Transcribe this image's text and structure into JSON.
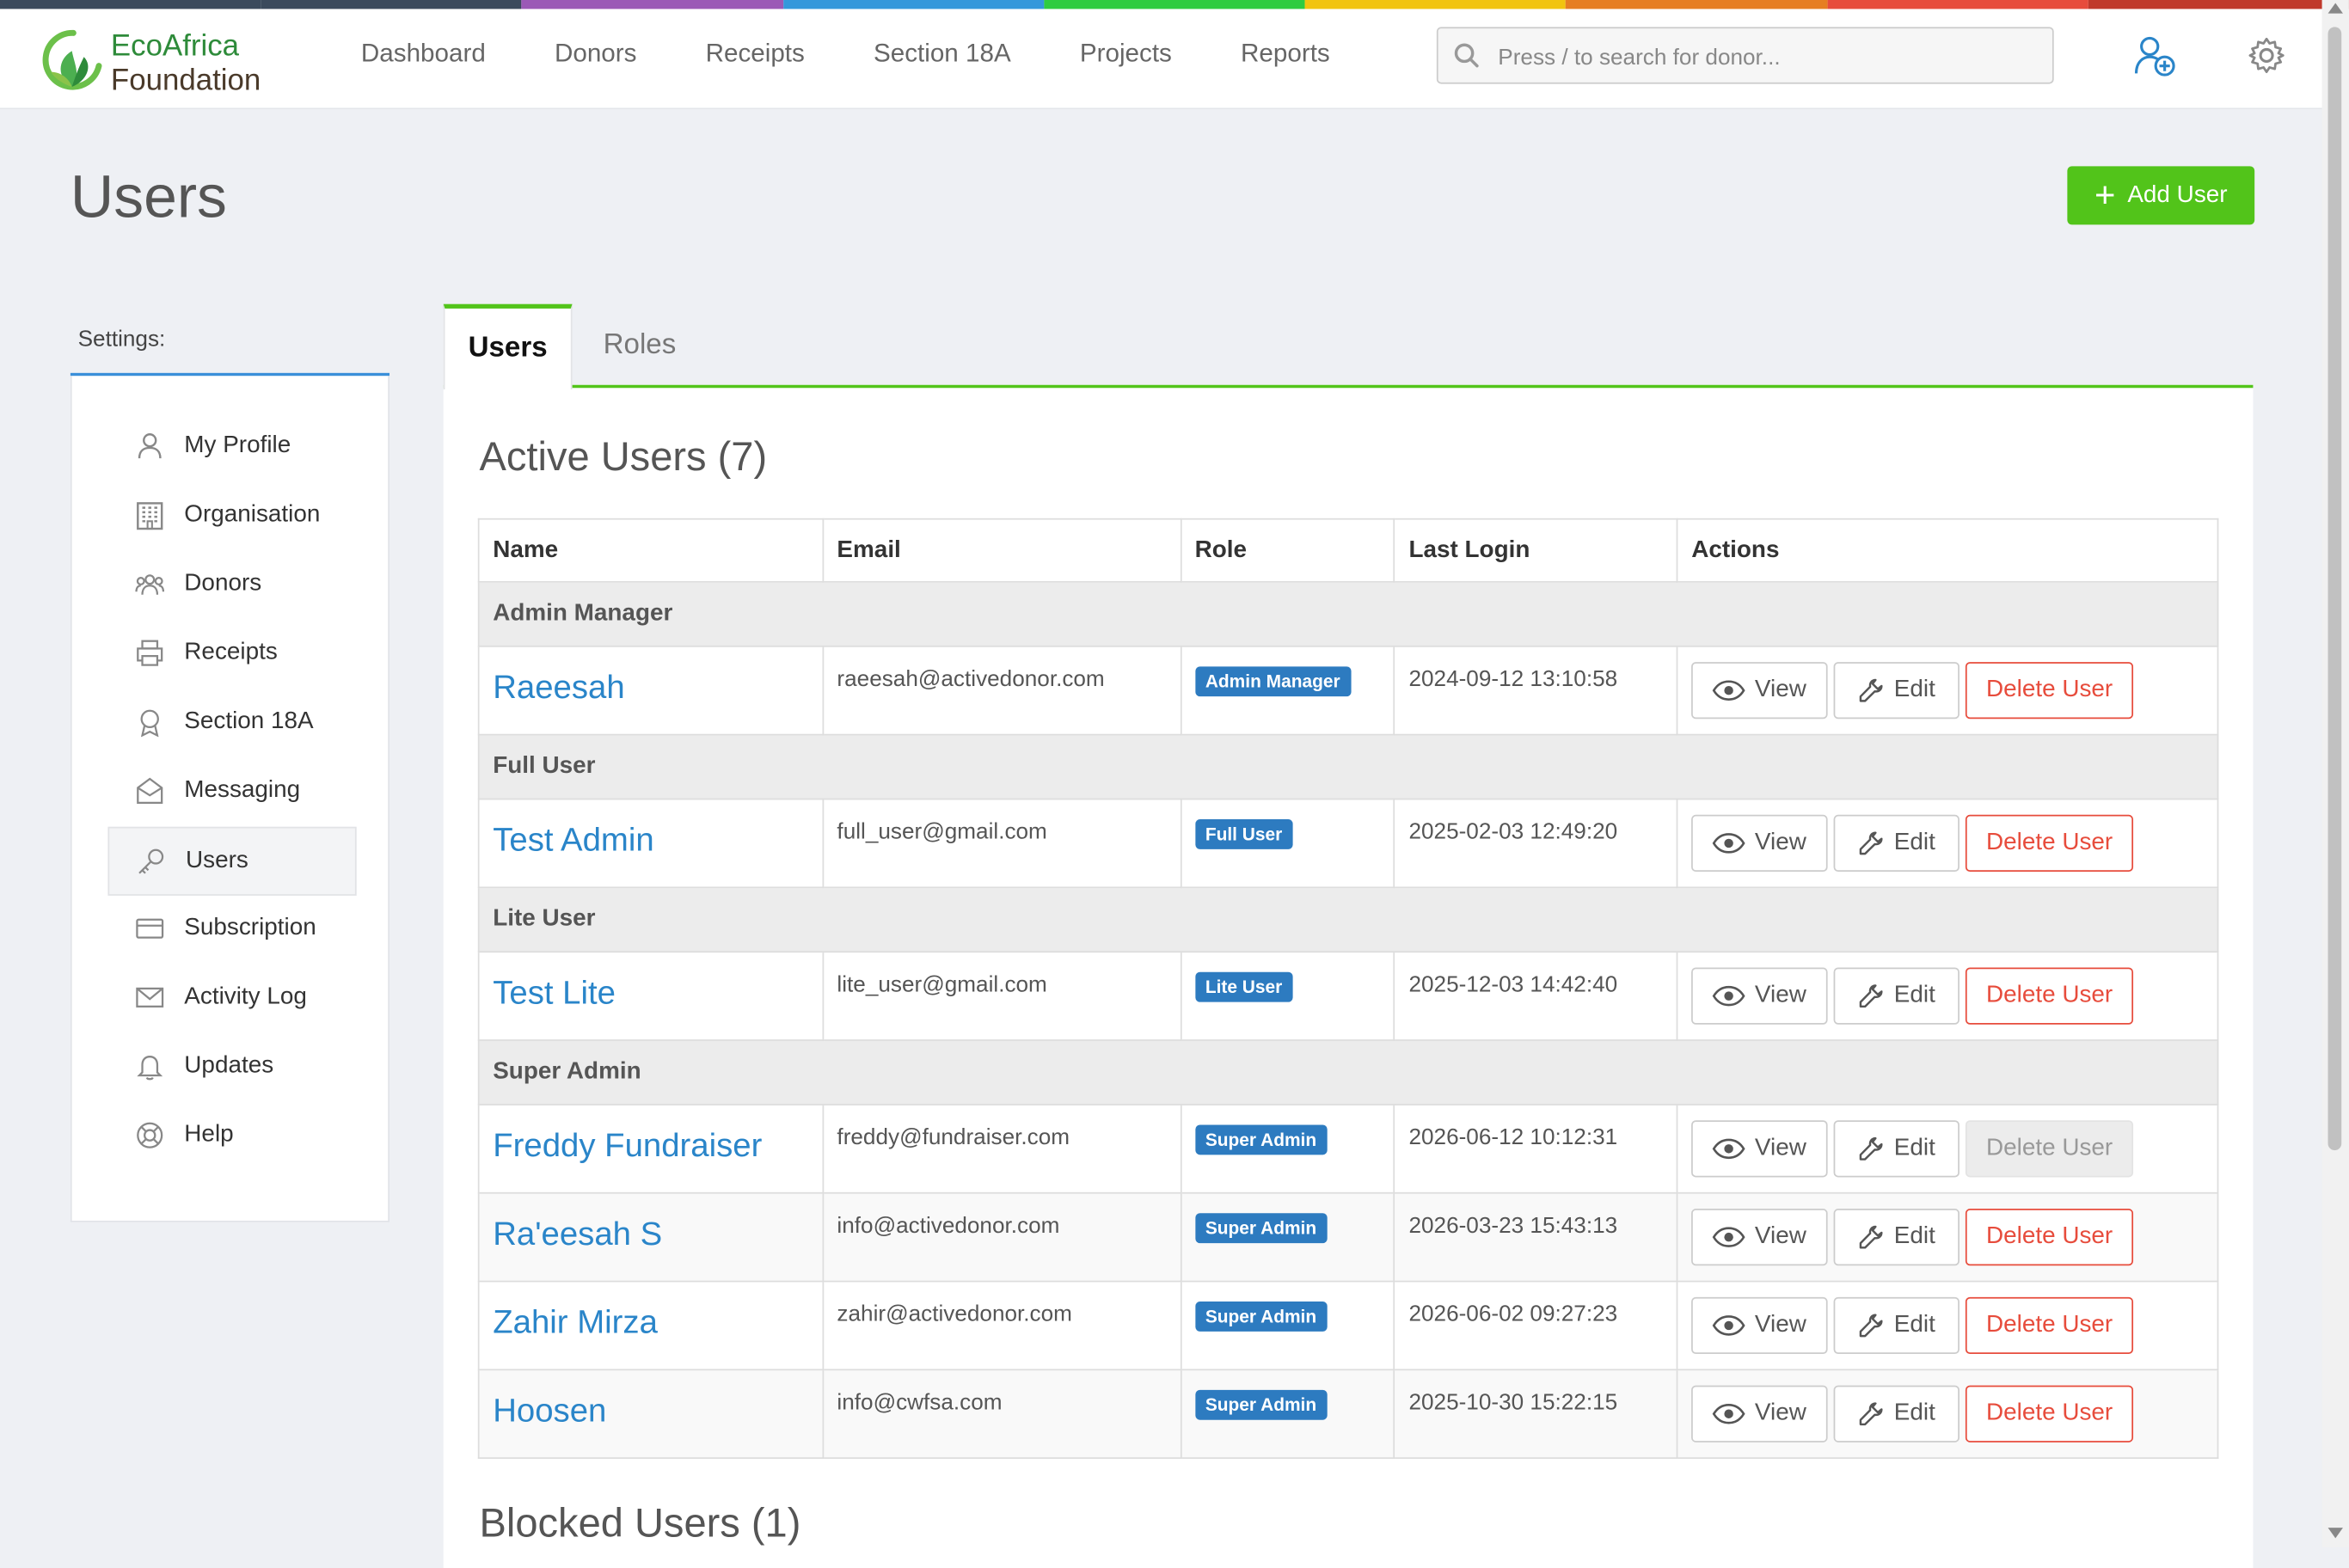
{
  "brand": {
    "line1": "EcoAfrica",
    "line2": "Foundation"
  },
  "colors": {
    "accent_green": "#52c41a",
    "link_blue": "#2a85c9",
    "badge_blue": "#2d7bc0",
    "danger": "#e74c3c",
    "strip": [
      "#3b4a5c",
      "#3b4a5c",
      "#9b59b6",
      "#3498db",
      "#2ecc40",
      "#f1c40f",
      "#e67e22",
      "#e74c3c",
      "#c0392b"
    ]
  },
  "nav": {
    "items": [
      "Dashboard",
      "Donors",
      "Receipts",
      "Section 18A",
      "Projects",
      "Reports"
    ]
  },
  "search": {
    "placeholder": "Press / to search for donor..."
  },
  "page": {
    "title": "Users",
    "add_button": "Add User"
  },
  "settings": {
    "label": "Settings:",
    "items": [
      {
        "label": "My Profile",
        "icon": "user-icon"
      },
      {
        "label": "Organisation",
        "icon": "building-icon"
      },
      {
        "label": "Donors",
        "icon": "users-group-icon"
      },
      {
        "label": "Receipts",
        "icon": "printer-icon"
      },
      {
        "label": "Section 18A",
        "icon": "award-icon"
      },
      {
        "label": "Messaging",
        "icon": "envelope-open-icon"
      },
      {
        "label": "Users",
        "icon": "key-icon",
        "active": true
      },
      {
        "label": "Subscription",
        "icon": "credit-card-icon"
      },
      {
        "label": "Activity Log",
        "icon": "mail-icon"
      },
      {
        "label": "Updates",
        "icon": "bell-icon"
      },
      {
        "label": "Help",
        "icon": "lifebuoy-icon"
      }
    ]
  },
  "tabs": [
    "Users",
    "Roles"
  ],
  "active_users": {
    "title": "Active Users (7)",
    "columns": [
      "Name",
      "Email",
      "Role",
      "Last Login",
      "Actions"
    ],
    "actions": {
      "view": "View",
      "edit": "Edit",
      "delete": "Delete User"
    },
    "groups": [
      {
        "name": "Admin Manager",
        "users": [
          {
            "name": "Raeesah",
            "email": "raeesah@activedonor.com",
            "role": "Admin Manager",
            "last_login": "2024-09-12 13:10:58"
          }
        ]
      },
      {
        "name": "Full User",
        "users": [
          {
            "name": "Test Admin",
            "email": "full_user@gmail.com",
            "role": "Full User",
            "last_login": "2025-02-03 12:49:20"
          }
        ]
      },
      {
        "name": "Lite User",
        "users": [
          {
            "name": "Test Lite",
            "email": "lite_user@gmail.com",
            "role": "Lite User",
            "last_login": "2025-12-03 14:42:40"
          }
        ]
      },
      {
        "name": "Super Admin",
        "users": [
          {
            "name": "Freddy Fundraiser",
            "email": "freddy@fundraiser.com",
            "role": "Super Admin",
            "last_login": "2026-06-12 10:12:31",
            "delete_disabled": true
          },
          {
            "name": "Ra'eesah S",
            "email": "info@activedonor.com",
            "role": "Super Admin",
            "last_login": "2026-03-23 15:43:13"
          },
          {
            "name": "Zahir Mirza",
            "email": "zahir@activedonor.com",
            "role": "Super Admin",
            "last_login": "2026-06-02 09:27:23"
          },
          {
            "name": "Hoosen",
            "email": "info@cwfsa.com",
            "role": "Super Admin",
            "last_login": "2025-10-30 15:22:15"
          }
        ]
      }
    ]
  },
  "blocked_users": {
    "title": "Blocked Users (1)"
  }
}
